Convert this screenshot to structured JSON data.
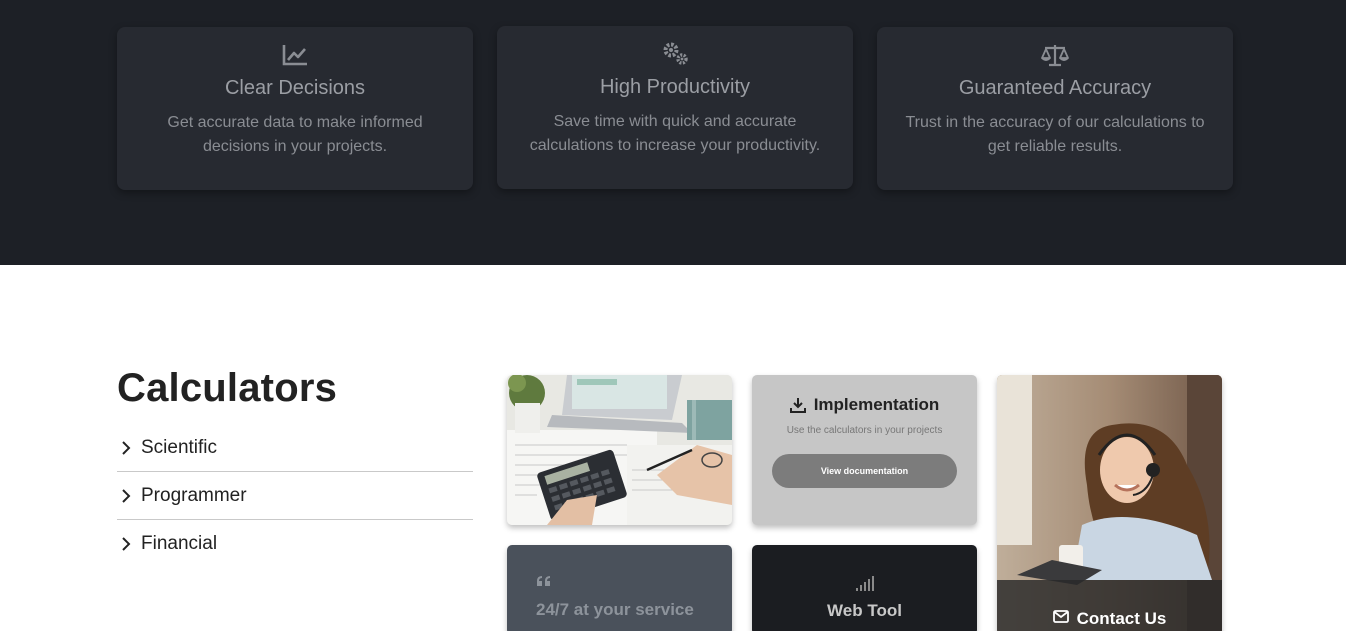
{
  "features": [
    {
      "icon": "line-chart-icon",
      "title": "Clear Decisions",
      "desc_line1": "Get accurate data to make informed",
      "desc_line2": "decisions in your projects."
    },
    {
      "icon": "gears-icon",
      "title": "High Productivity",
      "desc_line1": "Save time with quick and accurate",
      "desc_line2": "calculations to increase your productivity."
    },
    {
      "icon": "balance-scale-icon",
      "title": "Guaranteed Accuracy",
      "desc_line1": "Trust in the accuracy of our calculations to",
      "desc_line2": "get reliable results."
    }
  ],
  "calculators": {
    "title": "Calculators",
    "items": [
      "Scientific",
      "Programmer",
      "Financial"
    ]
  },
  "tiles": {
    "implementation": {
      "title": "Implementation",
      "subtitle": "Use the calculators in your projects",
      "button": "View documentation"
    },
    "service": {
      "text": "24/7 at your service"
    },
    "web_tool": {
      "text": "Web Tool"
    },
    "contact": {
      "text": "Contact Us"
    }
  },
  "colors": {
    "hero_bg": "#1d2026",
    "card_bg": "#272a31",
    "accent_gray": "#7c7c7c"
  }
}
